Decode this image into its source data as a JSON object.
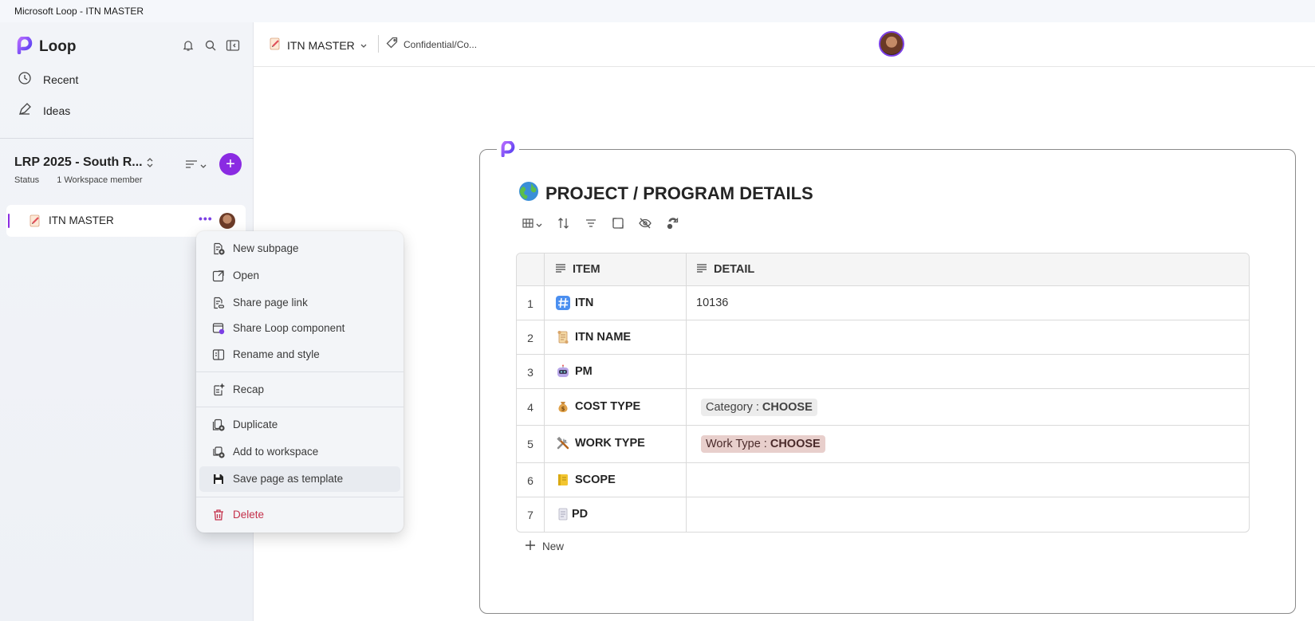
{
  "window": {
    "title": "Microsoft Loop - ITN MASTER"
  },
  "sidebar": {
    "brand": "Loop",
    "nav": [
      {
        "label": "Recent",
        "icon": "clock-icon"
      },
      {
        "label": "Ideas",
        "icon": "pen-icon"
      }
    ],
    "workspace": {
      "name": "LRP 2025 - South R...",
      "status": "Status",
      "members": "1 Workspace member",
      "add_label": "+"
    },
    "pages": [
      {
        "label": "ITN MASTER",
        "more": "•••"
      }
    ]
  },
  "context_menu": {
    "items": [
      {
        "label": "New subpage",
        "icon": "new-subpage-icon"
      },
      {
        "label": "Open",
        "icon": "open-external-icon"
      },
      {
        "label": "Share page link",
        "icon": "share-link-icon"
      },
      {
        "label": "Share Loop component",
        "icon": "loop-component-icon"
      },
      {
        "label": "Rename and style",
        "icon": "rename-icon"
      },
      {
        "label": "Recap",
        "icon": "recap-icon"
      },
      {
        "label": "Duplicate",
        "icon": "duplicate-icon"
      },
      {
        "label": "Add to workspace",
        "icon": "add-workspace-icon"
      },
      {
        "label": "Save page as template",
        "icon": "save-icon"
      },
      {
        "label": "Delete",
        "icon": "trash-icon"
      }
    ]
  },
  "header": {
    "page_title": "ITN MASTER",
    "sensitivity_label": "Confidential/Co..."
  },
  "component": {
    "title": "PROJECT / PROGRAM DETAILS",
    "table": {
      "columns": [
        "ITEM",
        "DETAIL"
      ],
      "rows": [
        {
          "num": "1",
          "item": "ITN",
          "emoji": "hash-emoji",
          "detail": "10136"
        },
        {
          "num": "2",
          "item": "ITN NAME",
          "emoji": "scroll-emoji",
          "detail": ""
        },
        {
          "num": "3",
          "item": "PM",
          "emoji": "robot-emoji",
          "detail": ""
        },
        {
          "num": "4",
          "item": "COST TYPE",
          "emoji": "money-bag-emoji",
          "pill_key": "Category : ",
          "pill_value": "CHOOSE"
        },
        {
          "num": "5",
          "item": "WORK TYPE",
          "emoji": "tools-emoji",
          "pill_key": "Work Type : ",
          "pill_value": "CHOOSE"
        },
        {
          "num": "6",
          "item": "SCOPE",
          "emoji": "ledger-emoji",
          "detail": ""
        },
        {
          "num": "7",
          "item": "PD",
          "emoji": "document-emoji",
          "detail": ""
        }
      ],
      "new_label": "New"
    }
  },
  "colors": {
    "accent": "#8a2be2",
    "danger": "#c4314b",
    "pill_gray": "#ececec",
    "pill_rose": "#e8cfcc"
  }
}
